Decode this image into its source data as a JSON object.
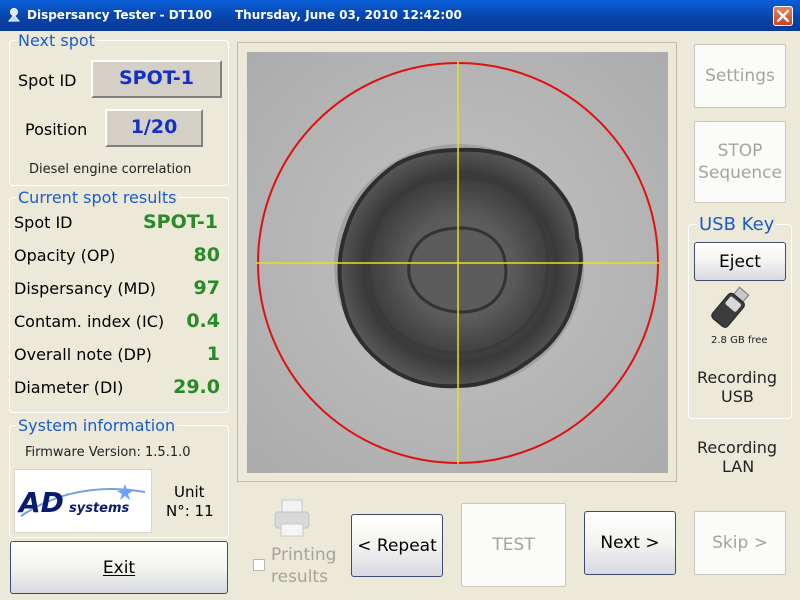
{
  "titlebar": {
    "app_title": "Dispersancy Tester - DT100",
    "datetime": "Thursday, June 03, 2010   12:42:00"
  },
  "next_spot": {
    "title": "Next spot",
    "spot_id_label": "Spot ID",
    "spot_id_value": "SPOT-1",
    "position_label": "Position",
    "position_value": "1/20",
    "correlation": "Diesel engine correlation"
  },
  "results": {
    "title": "Current spot results",
    "rows": [
      {
        "label": "Spot ID",
        "value": "SPOT-1"
      },
      {
        "label": "Opacity (OP)",
        "value": "80"
      },
      {
        "label": "Dispersancy (MD)",
        "value": "97"
      },
      {
        "label": "Contam. index (IC)",
        "value": "0.4"
      },
      {
        "label": "Overall note (DP)",
        "value": "1"
      },
      {
        "label": "Diameter (DI)",
        "value": "29.0"
      }
    ]
  },
  "system": {
    "title": "System information",
    "firmware": "Firmware Version: 1.5.1.0",
    "logo_text": "AD systems",
    "unit_label": "Unit",
    "unit_number": "N°: 11"
  },
  "buttons": {
    "exit": "Exit",
    "repeat": "< Repeat",
    "test": "TEST",
    "next": "Next >",
    "skip": "Skip >",
    "settings": "Settings",
    "stop_line1": "STOP",
    "stop_line2": "Sequence",
    "eject": "Eject"
  },
  "printing": {
    "line1": "Printing",
    "line2": "results",
    "checked": false
  },
  "usb": {
    "title": "USB Key",
    "free": "2.8 GB free",
    "recording_usb_line1": "Recording",
    "recording_usb_line2": "USB"
  },
  "lan": {
    "line1": "Recording",
    "line2": "LAN"
  },
  "colors": {
    "accent_blue": "#1c5cc8",
    "value_green": "#2a8a2a",
    "circle_red": "#e01010",
    "crosshair_yellow": "#e8e020"
  }
}
